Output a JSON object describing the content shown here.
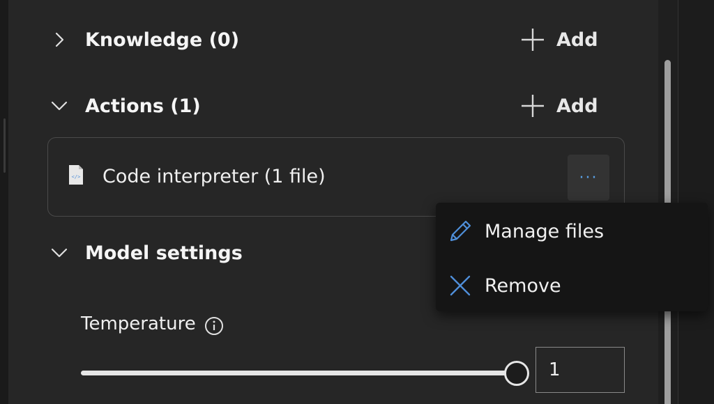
{
  "sections": {
    "knowledge": {
      "title": "Knowledge (0)",
      "add_label": "Add",
      "chevron": "chevron-right-icon"
    },
    "actions": {
      "title": "Actions (1)",
      "add_label": "Add",
      "chevron": "chevron-down-icon"
    },
    "model_settings": {
      "title": "Model settings",
      "chevron": "chevron-down-icon"
    }
  },
  "actions_list": [
    {
      "name": "Code interpreter (1 file)",
      "icon": "code-file-icon",
      "more_icon": "more-horizontal-icon",
      "more_glyph": "···"
    }
  ],
  "context_menu": {
    "items": [
      {
        "label": "Manage files",
        "icon": "pencil-icon"
      },
      {
        "label": "Remove",
        "icon": "close-icon"
      }
    ]
  },
  "temperature": {
    "label": "Temperature",
    "info_icon": "info-icon",
    "value": "1",
    "slider_fraction": 1.0
  },
  "colors": {
    "panel_bg": "#262626",
    "menu_bg": "#151515",
    "accent_blue": "#4f8fd9",
    "text": "#f0f0f0"
  }
}
